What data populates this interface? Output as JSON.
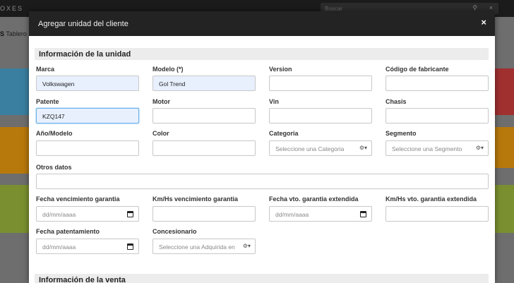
{
  "background": {
    "logo": "OXES",
    "search_placeholder": "Buscar",
    "side_label_prefix": "S",
    "side_label": "Tablero",
    "tile_colors": [
      "#3a7fa0",
      "#b8790c",
      "#7a9030"
    ],
    "right_tile_colors": [
      "#a03030",
      "#b8790c",
      "#7a9030"
    ]
  },
  "modal": {
    "title": "Agregar unidad del cliente",
    "close_label": "×"
  },
  "section_unit": {
    "title": "Información de la unidad"
  },
  "section_sale": {
    "title": "Información de la venta"
  },
  "fields": {
    "marca": {
      "label": "Marca",
      "value": "Volkswagen"
    },
    "modelo": {
      "label": "Modelo (*)",
      "value": "Gol Trend"
    },
    "version": {
      "label": "Version",
      "value": ""
    },
    "codigo": {
      "label": "Código de fabricante",
      "value": ""
    },
    "patente": {
      "label": "Patente",
      "value": "KZQ147"
    },
    "motor": {
      "label": "Motor",
      "value": ""
    },
    "vin": {
      "label": "Vin",
      "value": ""
    },
    "chasis": {
      "label": "Chasis",
      "value": ""
    },
    "anio": {
      "label": "Año/Modelo",
      "value": ""
    },
    "color": {
      "label": "Color",
      "value": ""
    },
    "categoria": {
      "label": "Categoria",
      "placeholder": "Seleccione una Categoria"
    },
    "segmento": {
      "label": "Segmento",
      "placeholder": "Seleccione una Segmento"
    },
    "otros": {
      "label": "Otros datos",
      "value": ""
    },
    "fecha_venc": {
      "label": "Fecha vencimiento garantia",
      "placeholder": "dd/mm/aaaa"
    },
    "kmhs_venc": {
      "label": "Km/Hs vencimiento garantia",
      "value": ""
    },
    "fecha_vto_ext": {
      "label": "Fecha vto. garantia extendida",
      "placeholder": "dd/mm/aaaa"
    },
    "kmhs_vto_ext": {
      "label": "Km/Hs vto. garantia extendida",
      "value": ""
    },
    "fecha_pat": {
      "label": "Fecha patentamiento",
      "placeholder": "dd/mm/aaaa"
    },
    "concesionario": {
      "label": "Concesionario",
      "placeholder": "Seleccione una Adquirida en"
    }
  }
}
